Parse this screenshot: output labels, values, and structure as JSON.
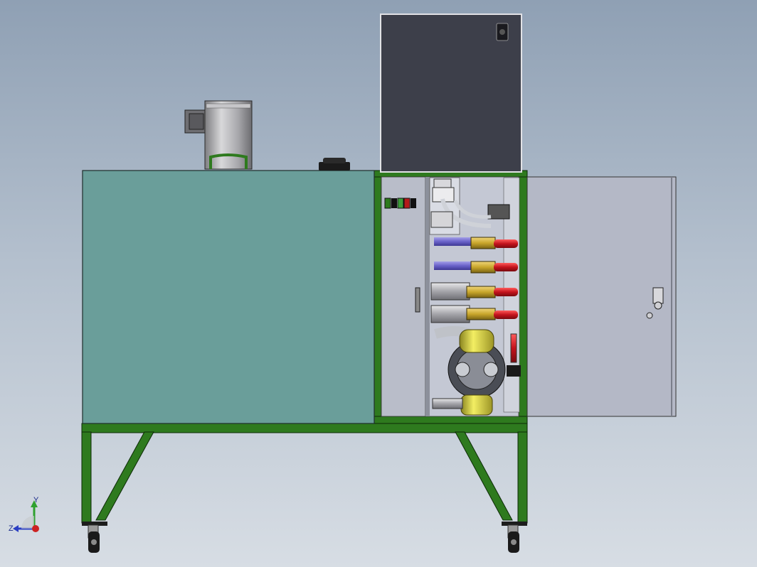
{
  "viewport": {
    "background_top": "#8fa0b4",
    "background_bottom": "#d7dde4"
  },
  "model": {
    "tank_color": "#6a9e9a",
    "frame_color": "#2e7a1e",
    "cabinet_color": "#3d3f4a",
    "door_color": "#b4b8c6",
    "valve_handle_color": "#c3131c",
    "fitting_color": "#c9a62b",
    "hose_color": "#6a62c9",
    "pump_color": "#d9d23a"
  },
  "triad": {
    "y_label": "Y",
    "z_label": "Z",
    "y_color": "#2fa12f",
    "z_color": "#2b3fc4",
    "x_color": "#cc2222"
  }
}
